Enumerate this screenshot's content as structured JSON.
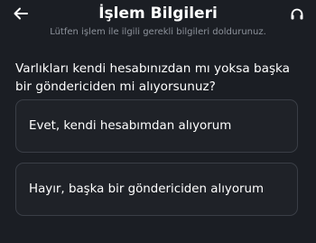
{
  "header": {
    "title": "İşlem Bilgileri",
    "subtitle": "Lütfen işlem ile ilgili gerekli bilgileri doldurunuz.",
    "back_icon": "arrow-left-icon",
    "support_icon": "headset-icon"
  },
  "question": {
    "text": "Varlıkları kendi hesabınızdan mı yoksa başka bir göndericiden mi alıyorsunuz?"
  },
  "options": [
    {
      "label": "Evet, kendi hesabımdan alıyorum"
    },
    {
      "label": "Hayır, başka bir göndericiden alıyorum"
    }
  ],
  "colors": {
    "background": "#1b1e24",
    "option_border": "#3a3e46",
    "subtitle": "#8e939c"
  }
}
